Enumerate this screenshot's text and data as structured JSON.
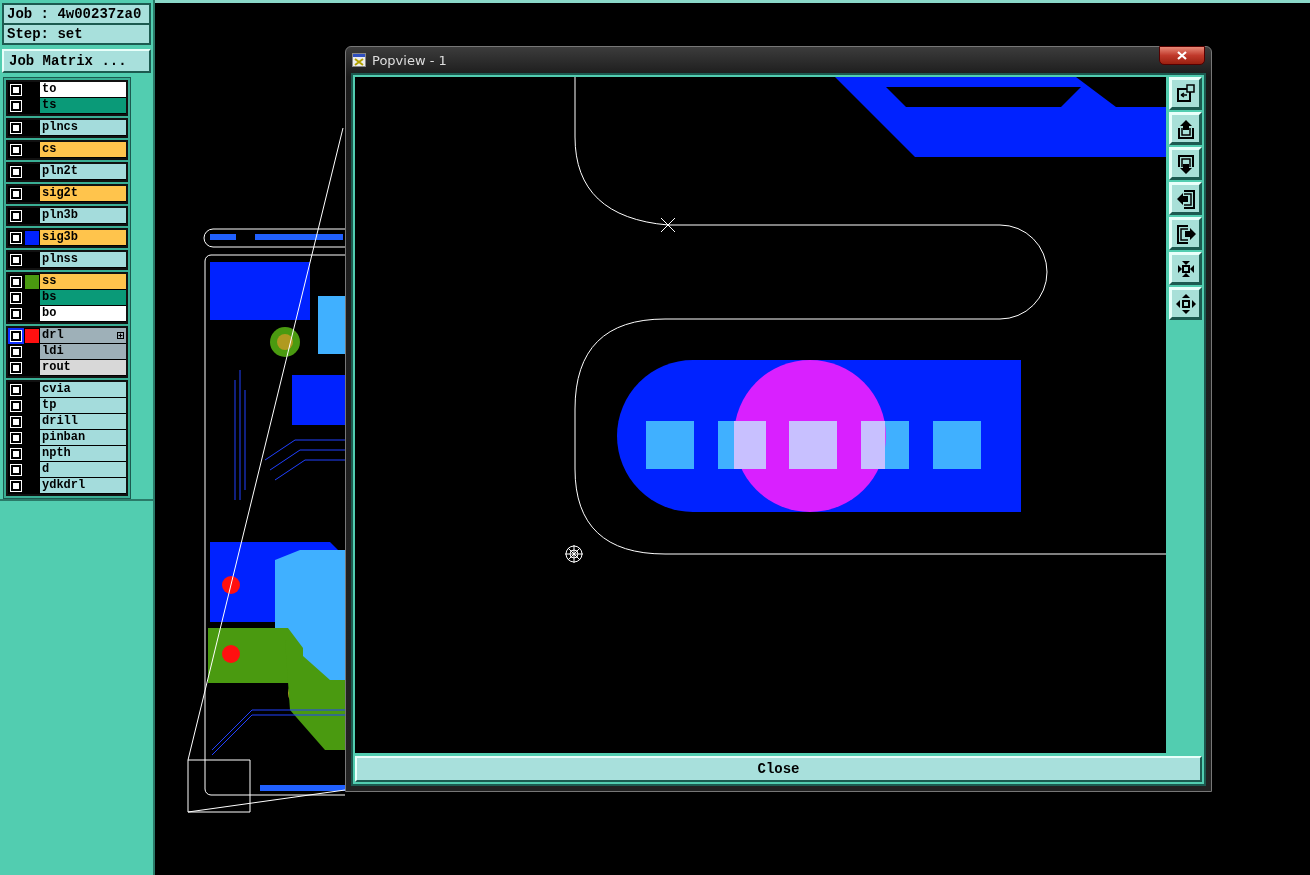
{
  "job_panel": {
    "job": "Job : 4w00237za0",
    "step": "Step: set",
    "matrix_button": "Job Matrix ..."
  },
  "layer_groups": [
    [
      {
        "name": "to",
        "color": "#ffffff",
        "checked": false,
        "work_layer": false,
        "sublayers": false
      },
      {
        "name": "ts",
        "color": "#0a9a78",
        "checked": false,
        "work_layer": false,
        "sublayers": false
      }
    ],
    [
      {
        "name": "plncs",
        "color": "#a4dcdc",
        "checked": false,
        "work_layer": false,
        "sublayers": false
      }
    ],
    [
      {
        "name": "cs",
        "color": "#ffc44c",
        "checked": false,
        "work_layer": false,
        "sublayers": false
      }
    ],
    [
      {
        "name": "pln2t",
        "color": "#a4dcdc",
        "checked": false,
        "work_layer": false,
        "sublayers": false
      }
    ],
    [
      {
        "name": "sig2t",
        "color": "#ffc44c",
        "checked": false,
        "work_layer": false,
        "sublayers": false
      }
    ],
    [
      {
        "name": "pln3b",
        "color": "#a4dcdc",
        "checked": false,
        "work_layer": false,
        "sublayers": false
      }
    ],
    [
      {
        "name": "sig3b",
        "color": "#ffc44c",
        "swatch": {
          "color": "#0022ff"
        },
        "checked": false,
        "work_layer": false,
        "sublayers": false
      }
    ],
    [
      {
        "name": "plnss",
        "color": "#a4dcdc",
        "checked": false,
        "work_layer": false,
        "sublayers": false
      }
    ],
    [
      {
        "name": "ss",
        "color": "#ffc44c",
        "swatch": {
          "color": "#4a9a10"
        },
        "checked": false,
        "work_layer": false,
        "sublayers": false
      },
      {
        "name": "bs",
        "color": "#0a9a78",
        "checked": false,
        "work_layer": false,
        "sublayers": false
      },
      {
        "name": "bo",
        "color": "#ffffff",
        "checked": false,
        "work_layer": false,
        "sublayers": false
      }
    ],
    [
      {
        "name": "drl",
        "color": "#9eb0b8",
        "swatch": {
          "color": "#ff1010"
        },
        "checked": false,
        "work_layer": true,
        "sublayers": true
      },
      {
        "name": "ldi",
        "color": "#9eb0b8",
        "checked": false,
        "work_layer": false,
        "sublayers": false
      },
      {
        "name": "rout",
        "color": "#d8d8d8",
        "checked": false,
        "work_layer": false,
        "sublayers": false
      }
    ],
    [
      {
        "name": "cvia",
        "color": "#a4dcdc",
        "checked": false,
        "work_layer": false,
        "sublayers": false
      },
      {
        "name": "tp",
        "color": "#a4dcdc",
        "checked": false,
        "work_layer": false,
        "sublayers": false
      },
      {
        "name": "drill",
        "color": "#a4dcdc",
        "checked": false,
        "work_layer": false,
        "sublayers": false
      },
      {
        "name": "pinban",
        "color": "#a4dcdc",
        "checked": false,
        "work_layer": false,
        "sublayers": false
      },
      {
        "name": "npth",
        "color": "#a4dcdc",
        "checked": false,
        "work_layer": false,
        "sublayers": false
      },
      {
        "name": "d",
        "color": "#a4dcdc",
        "checked": false,
        "work_layer": false,
        "sublayers": false
      },
      {
        "name": "ydkdrl",
        "color": "#a4dcdc",
        "checked": false,
        "work_layer": false,
        "sublayers": false
      }
    ]
  ],
  "popup": {
    "title": "Popview - 1",
    "tools": [
      {
        "kind": "window"
      },
      {
        "kind": "up"
      },
      {
        "kind": "down"
      },
      {
        "kind": "left"
      },
      {
        "kind": "right"
      },
      {
        "kind": "shrink"
      },
      {
        "kind": "expand"
      }
    ],
    "close_label": "Close"
  }
}
